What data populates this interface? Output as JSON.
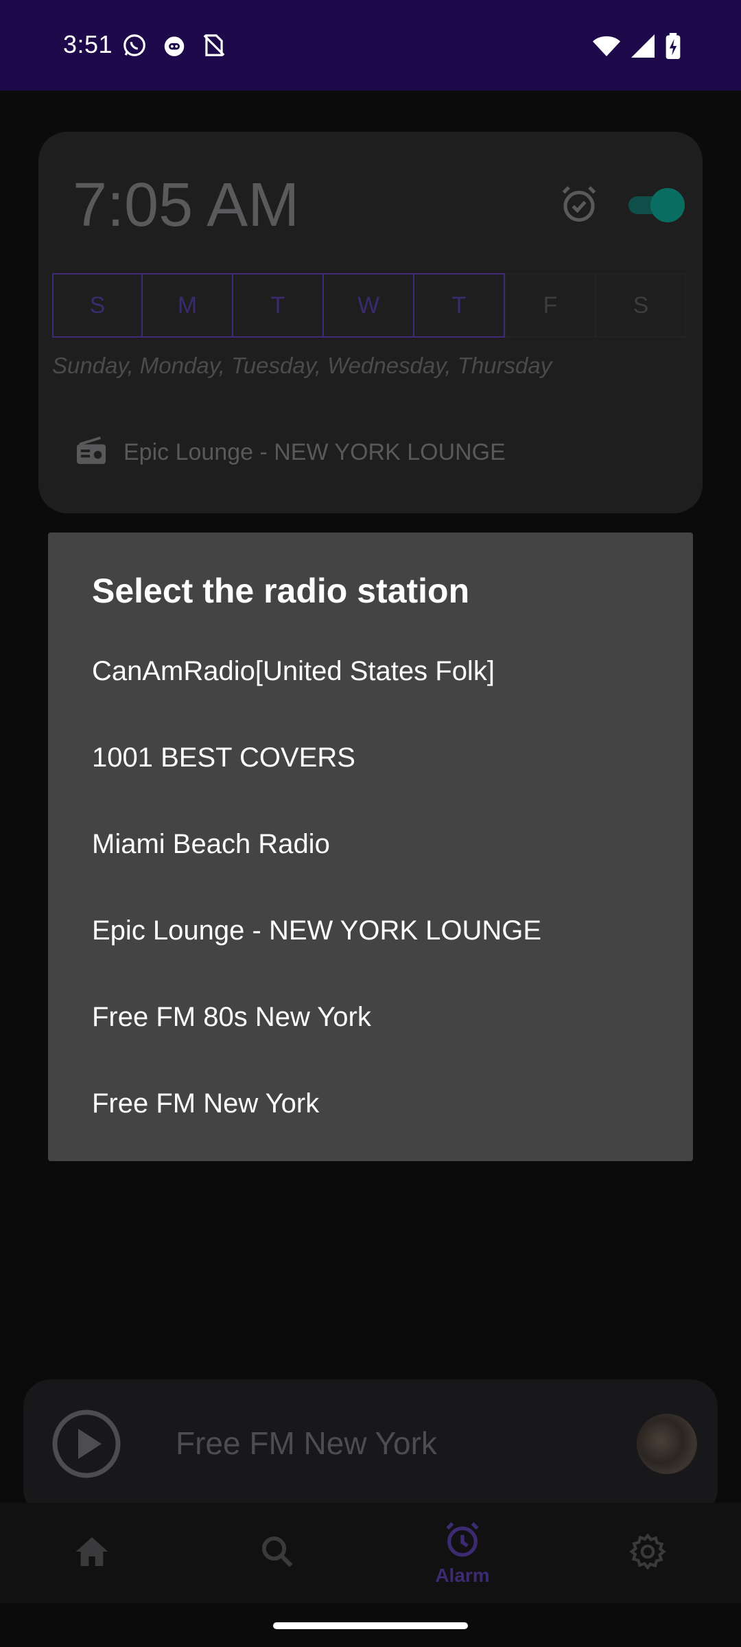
{
  "status_bar": {
    "time": "3:51",
    "left_icons": [
      "whatsapp-icon",
      "cat-icon",
      "sim-alert-icon"
    ],
    "right_icons": [
      "wifi-icon",
      "signal-icon",
      "battery-charging-icon"
    ]
  },
  "alarm": {
    "time": "7:05 AM",
    "enabled": true,
    "days": [
      {
        "label": "S",
        "on": true
      },
      {
        "label": "M",
        "on": true
      },
      {
        "label": "T",
        "on": true
      },
      {
        "label": "W",
        "on": true
      },
      {
        "label": "T",
        "on": true
      },
      {
        "label": "F",
        "on": false
      },
      {
        "label": "S",
        "on": false
      }
    ],
    "days_text": "Sunday, Monday, Tuesday, Wednesday, Thursday",
    "station": "Epic Lounge - NEW YORK LOUNGE"
  },
  "dialog": {
    "title": "Select the radio station",
    "options": [
      "CanAmRadio[United States Folk]",
      "1001 BEST COVERS",
      "Miami Beach Radio",
      "Epic Lounge - NEW YORK LOUNGE",
      "Free FM 80s New York",
      "Free FM New York"
    ]
  },
  "player": {
    "title": "Free FM New York"
  },
  "nav": {
    "items": [
      {
        "name": "home",
        "label": ""
      },
      {
        "name": "search",
        "label": ""
      },
      {
        "name": "alarm",
        "label": "Alarm"
      },
      {
        "name": "settings",
        "label": ""
      }
    ],
    "active": "alarm"
  },
  "colors": {
    "status_bar": "#1e0a4a",
    "accent": "#3c2a72",
    "toggle": "#0a6d62",
    "dialog_bg": "#444445"
  }
}
